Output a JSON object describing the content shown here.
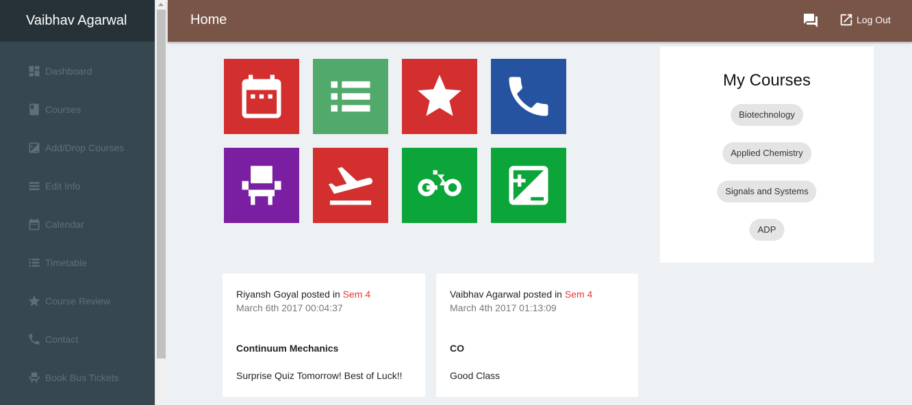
{
  "sidebar": {
    "user_name": "Vaibhav Agarwal",
    "items": [
      {
        "label": "Dashboard",
        "icon": "dashboard-icon"
      },
      {
        "label": "Courses",
        "icon": "book-icon"
      },
      {
        "label": "Add/Drop Courses",
        "icon": "add-drop-icon"
      },
      {
        "label": "Edit Info",
        "icon": "list-icon"
      },
      {
        "label": "Calendar",
        "icon": "calendar-icon"
      },
      {
        "label": "Timetable",
        "icon": "timetable-icon"
      },
      {
        "label": "Course Review",
        "icon": "star-icon"
      },
      {
        "label": "Contact",
        "icon": "phone-icon"
      },
      {
        "label": "Book Bus Tickets",
        "icon": "seat-icon"
      }
    ]
  },
  "header": {
    "title": "Home",
    "chat_icon": "chat-icon",
    "logout_label": "Log Out",
    "logout_icon": "open-external-icon",
    "color": "#795548"
  },
  "tiles": [
    {
      "icon": "calendar-icon",
      "color": "#d32f2f"
    },
    {
      "icon": "list-icon",
      "color": "#52a96c"
    },
    {
      "icon": "star-icon",
      "color": "#d32f2f"
    },
    {
      "icon": "phone-icon",
      "color": "#2553a0"
    },
    {
      "icon": "seat-icon",
      "color": "#7b1fa2"
    },
    {
      "icon": "flight-takeoff-icon",
      "color": "#d32f2f"
    },
    {
      "icon": "bike-icon",
      "color": "#0ca53a"
    },
    {
      "icon": "plus-minus-icon",
      "color": "#0ca53a"
    }
  ],
  "my_courses": {
    "title": "My Courses",
    "courses": [
      "Biotechnology",
      "Applied Chemistry",
      "Signals and Systems",
      "ADP"
    ]
  },
  "posts": [
    {
      "author": "Riyansh Goyal",
      "posted_in": "posted in",
      "group": "Sem 4",
      "date": "March 6th 2017 00:04:37",
      "title": "Continuum Mechanics",
      "body": "Surprise Quiz Tomorrow! Best of Luck!!"
    },
    {
      "author": "Vaibhav Agarwal",
      "posted_in": "posted in",
      "group": "Sem 4",
      "date": "March 4th 2017 01:13:09",
      "title": "CO",
      "body": "Good Class"
    }
  ]
}
